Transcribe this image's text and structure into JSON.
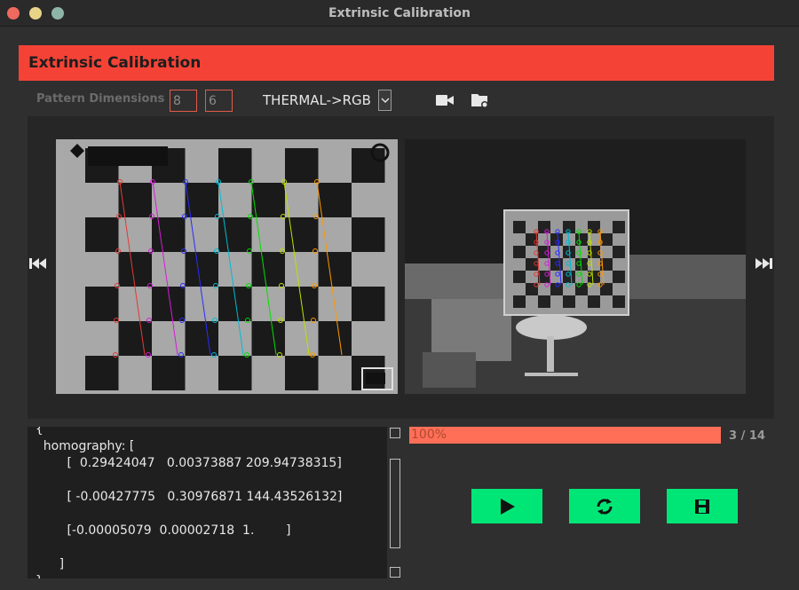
{
  "window": {
    "title": "Extrinsic Calibration"
  },
  "header": {
    "title": "Extrinsic Calibration"
  },
  "toolbar": {
    "pattern_label": "Pattern Dimensions",
    "pattern_rows": "8",
    "pattern_cols": "6",
    "mode": "THERMAL->RGB",
    "icons": [
      "camera-icon",
      "folder-icon"
    ]
  },
  "console": {
    "text": "  {\n    homography: [\n          [  0.29424047   0.00373887 209.94738315]\n\n          [ -0.00427775   0.30976871 144.43526132]\n\n          [-0.00005079  0.00002718  1.        ]\n\n        ]\n  }"
  },
  "progress": {
    "value": 100,
    "label": "100%"
  },
  "pager": {
    "text": "3 / 14"
  },
  "colors": {
    "header": "#f44336",
    "accent_button": "#00e676",
    "progress": "#ff6f57"
  }
}
